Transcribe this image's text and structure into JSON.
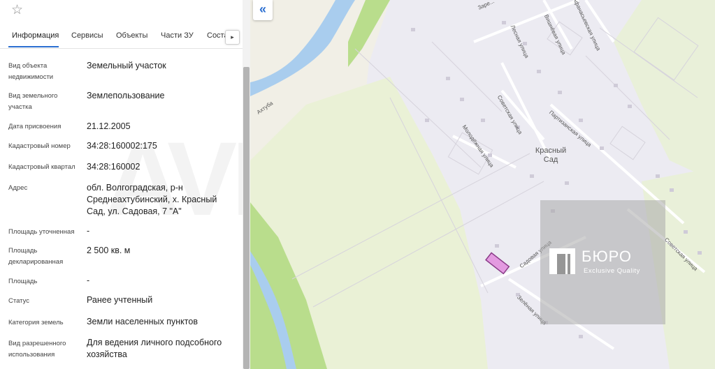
{
  "panel": {
    "star_icon": "star-outline-icon",
    "tabs": [
      {
        "label": "Информация",
        "active": true
      },
      {
        "label": "Сервисы",
        "active": false
      },
      {
        "label": "Объекты",
        "active": false
      },
      {
        "label": "Части ЗУ",
        "active": false
      },
      {
        "label": "Состав ЕЗ",
        "active": false
      }
    ],
    "tab_next_icon": "▸",
    "rows": [
      {
        "label": "Вид объекта недвижимости",
        "value": "Земельный участок"
      },
      {
        "label": "Вид земельного участка",
        "value": "Землепользование"
      },
      {
        "label": "Дата присвоения",
        "value": "21.12.2005"
      },
      {
        "label": "Кадастровый номер",
        "value": "34:28:160002:175"
      },
      {
        "label": "Кадастровый квартал",
        "value": "34:28:160002"
      },
      {
        "label": "Адрес",
        "value": "обл. Волгоградская, р-н Среднеахтубинский, х. Красный Сад, ул. Садовая, 7 \"А\""
      },
      {
        "label": "Площадь уточненная",
        "value": "-"
      },
      {
        "label": "Площадь декларированная",
        "value": "2 500 кв. м"
      },
      {
        "label": "Площадь",
        "value": "-"
      },
      {
        "label": "Статус",
        "value": "Ранее учтенный"
      },
      {
        "label": "Категория земель",
        "value": "Земли населенных пунктов"
      },
      {
        "label": "Вид разрешенного использования",
        "value": "Для ведения личного подсобного хозяйства"
      }
    ],
    "watermark": "AVITO"
  },
  "map": {
    "collapse_label": "«",
    "labels": {
      "river": "Ахтуба",
      "street_sovetskaya_1": "Советская улица",
      "street_molodezhnaya": "Молодёжная улица",
      "street_lesnaya": "Лесная улица",
      "street_vishnevaya": "Вишнёвая улица",
      "street_afanasievskaya": "Афанасьевская улица",
      "street_partizanskaya": "Партизанская улица",
      "street_sadovaya": "Садовая улица",
      "street_zelenaya": "Зелёная улица",
      "street_sovetskaya_2": "Советская улица",
      "street_zarechnaya": "Заре..."
    },
    "place_name": "Красный Сад",
    "colors": {
      "water": "#a9cdee",
      "forest": "#b9dd8c",
      "field": "#e8f0d0",
      "settlement": "#ecebf2",
      "parcel": "#e39ae0"
    }
  },
  "logo": {
    "title": "БЮРО",
    "subtitle": "Exclusive Quality"
  }
}
